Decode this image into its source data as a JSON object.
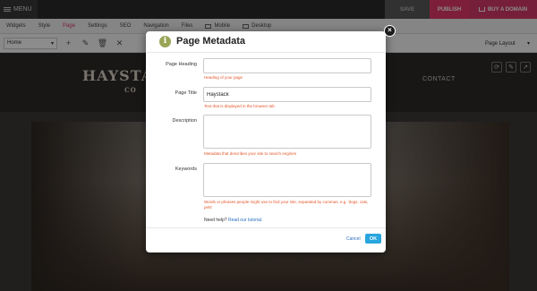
{
  "topbar": {
    "menu_label": "MENU",
    "save_label": "SAVE",
    "publish_label": "PUBLISH",
    "domain_label": "BUY A DOMAIN"
  },
  "tabs": [
    {
      "label": "Widgets"
    },
    {
      "label": "Style"
    },
    {
      "label": "Page"
    },
    {
      "label": "Settings"
    },
    {
      "label": "SEO"
    },
    {
      "label": "Navigation"
    },
    {
      "label": "Files"
    },
    {
      "label": "Mobile"
    },
    {
      "label": "Desktop"
    }
  ],
  "toolbar": {
    "page_select_value": "Home",
    "layout_select_value": "Page Layout"
  },
  "site": {
    "logo_text": "HAYSTACK",
    "logo_sub": "CO",
    "nav_contact": "CONTACT"
  },
  "modal": {
    "title": "Page Metadata",
    "fields": {
      "heading": {
        "label": "Page Heading",
        "value": "",
        "help": "Heading of your page"
      },
      "title": {
        "label": "Page Title",
        "value": "Haystack",
        "help": "Text that is displayed in the browser tab"
      },
      "description": {
        "label": "Description",
        "value": "",
        "help": "Metadata that describes your site to search engines"
      },
      "keywords": {
        "label": "Keywords",
        "value": "",
        "help": "Words or phrases people might use to find your site, separated by commas. e.g. 'dogs, cats, pets'"
      }
    },
    "help_prefix": "Need help?",
    "help_link": "Read our tutorial.",
    "cancel_label": "Cancel",
    "ok_label": "OK",
    "close_symbol": "×"
  },
  "colors": {
    "accent_pink": "#e43a6b",
    "ok_blue": "#29a6de",
    "help_orange": "#e2562a",
    "info_green": "#9aa557"
  }
}
